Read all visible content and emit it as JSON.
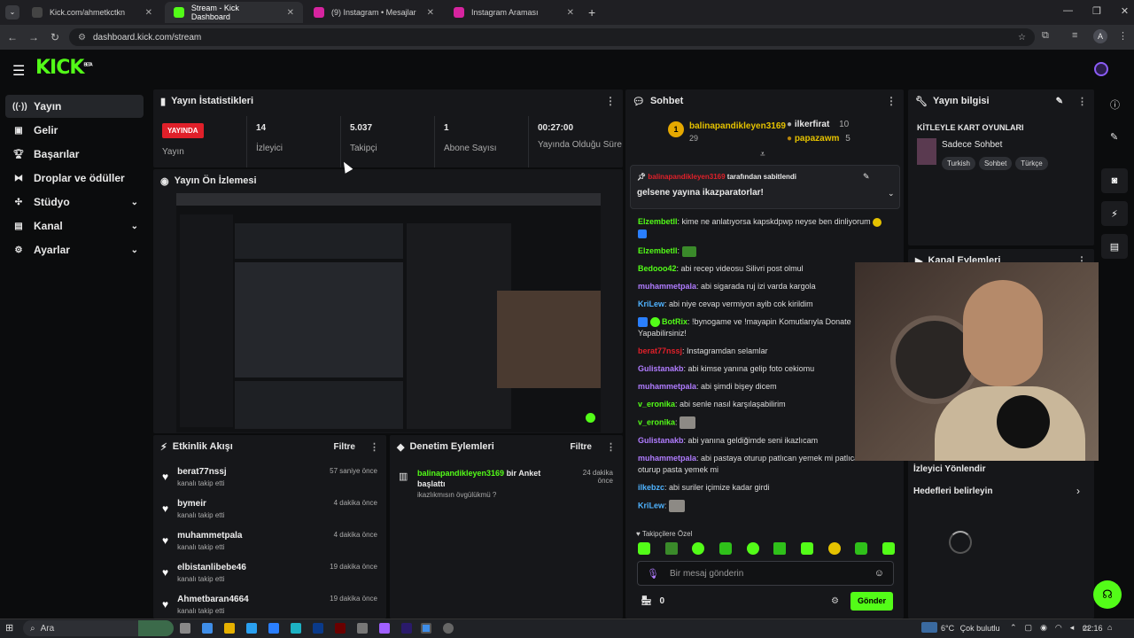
{
  "browser": {
    "tabs": [
      {
        "label": "Kick.com/ahmetkctkn"
      },
      {
        "label": "Stream - Kick Dashboard"
      },
      {
        "label": "(9) Instagram • Mesajlar"
      },
      {
        "label": "Instagram Araması"
      }
    ],
    "url": "dashboard.kick.com/stream",
    "profile_initial": "A"
  },
  "brand": {
    "logo": "KICK",
    "beta": "BETA"
  },
  "sidebar": {
    "items": [
      {
        "label": "Yayın",
        "icon": "broadcast-icon"
      },
      {
        "label": "Gelir",
        "icon": "income-icon"
      },
      {
        "label": "Başarılar",
        "icon": "trophy-icon"
      },
      {
        "label": "Droplar ve ödüller",
        "icon": "drops-icon"
      },
      {
        "label": "Stüdyo",
        "icon": "studio-icon"
      },
      {
        "label": "Kanal",
        "icon": "channel-icon"
      },
      {
        "label": "Ayarlar",
        "icon": "settings-icon"
      }
    ]
  },
  "stats": {
    "title": "Yayın İstatistikleri",
    "live_badge": "YAYINDA",
    "live_label": "Yayın",
    "viewers": {
      "value": "14",
      "label": "İzleyici"
    },
    "followers": {
      "value": "5.037",
      "label": "Takipçi"
    },
    "subs": {
      "value": "1",
      "label": "Abone Sayısı"
    },
    "uptime": {
      "value": "00:27:00",
      "label": "Yayında Olduğu Süre"
    }
  },
  "preview": {
    "title": "Yayın Ön İzlemesi"
  },
  "activity": {
    "title": "Etkinlik Akışı",
    "filter": "Filtre",
    "events": [
      {
        "name": "berat77nssj",
        "sub": "kanalı takip etti",
        "time": "57 saniye önce"
      },
      {
        "name": "bymeir",
        "sub": "kanalı takip etti",
        "time": "4 dakika önce"
      },
      {
        "name": "muhammetpala",
        "sub": "kanalı takip etti",
        "time": "4 dakika önce"
      },
      {
        "name": "elbistanlibebe46",
        "sub": "kanalı takip etti",
        "time": "19 dakika önce"
      },
      {
        "name": "Ahmetbaran4664",
        "sub": "kanalı takip etti",
        "time": "19 dakika önce"
      }
    ]
  },
  "moderation": {
    "title": "Denetim Eylemleri",
    "filter": "Filtre",
    "user": "balinapandikleyen3169",
    "action": "bir Anket başlattı",
    "question": "ikazlıkmısın övgülükmü ?",
    "time": "24 dakika önce"
  },
  "chat": {
    "title": "Sohbet",
    "leaders": [
      {
        "rank": "1",
        "name": "balinapandikleyen3169",
        "count": "29"
      },
      {
        "name": "ilkerfirat",
        "count": "10"
      },
      {
        "name": "papazawm",
        "count": "5"
      }
    ],
    "pinned": {
      "user": "balinapandikleyen3169",
      "suffix": "tarafından sabitlendi",
      "text": "gelsene yayına ikazparatorlar!"
    },
    "messages": [
      {
        "user": "Elzembetll",
        "text": "kime ne anlatıyorsa kapskdpwp neyse ben dinliyorum",
        "color": "#53fc18"
      },
      {
        "user": "Elzembetll",
        "text": "",
        "color": "#53fc18"
      },
      {
        "user": "Bedooo42",
        "text": "abi recep videosu Silivri post olmul",
        "color": "#53fc18"
      },
      {
        "user": "muhammetpala",
        "text": "abi sigarada ruj izi varda kargola",
        "color": "#b07cff"
      },
      {
        "user": "KriLew",
        "text": "abi niye cevap vermiyon ayib cok kirildim",
        "color": "#4fb3ff"
      },
      {
        "user": "BotRix",
        "text": "!bynogame ve !mayapin Komutlarıyla Donate Yapabilirsiniz!",
        "color": "#53fc18"
      },
      {
        "user": "berat77nssj",
        "text": "Instagramdan selamlar",
        "color": "#e0202a"
      },
      {
        "user": "Gulistanakb",
        "text": "abi kimse yanına gelip foto cekiomu",
        "color": "#b07cff"
      },
      {
        "user": "muhammetpala",
        "text": "abi şimdi bişey dicem",
        "color": "#b07cff"
      },
      {
        "user": "v_eronika",
        "text": "abi senle nasıl karşılaşabilirim",
        "color": "#53fc18"
      },
      {
        "user": "v_eronika",
        "text": "",
        "color": "#53fc18"
      },
      {
        "user": "Gulistanakb",
        "text": "abi yanına geldiğimde seni ikazlıcam",
        "color": "#b07cff"
      },
      {
        "user": "muhammetpala",
        "text": "abi pastaya oturup patlıcan yemek mi patlıcana oturup pasta yemek mi",
        "color": "#b07cff"
      },
      {
        "user": "ilkebzc",
        "text": "abi suriler içimize kadar girdi",
        "color": "#4fb3ff"
      },
      {
        "user": "KriLew",
        "text": "",
        "color": "#4fb3ff"
      }
    ],
    "followers_only": "Takipçilere Özel",
    "input_placeholder": "Bir mesaj gönderin",
    "points": "0",
    "send": "Gönder"
  },
  "info": {
    "title": "Yayın bilgisi",
    "stream_title": "KİTLEYLE KART OYUNLARI",
    "category": "Sadece Sohbet",
    "tags": [
      "Turkish",
      "Sohbet",
      "Türkçe"
    ]
  },
  "channel_actions": {
    "title": "Kanal Eylemleri",
    "item1": "İzleyici Yönlendir",
    "item2": "Hedefleri belirleyin"
  },
  "taskbar": {
    "search": "Ara",
    "weather": "6°C",
    "weather_text": "Çok bulutlu",
    "time": "22:16"
  },
  "colors": {
    "brand": "#53fc18",
    "live": "#e0202a",
    "panel": "#16171a"
  }
}
